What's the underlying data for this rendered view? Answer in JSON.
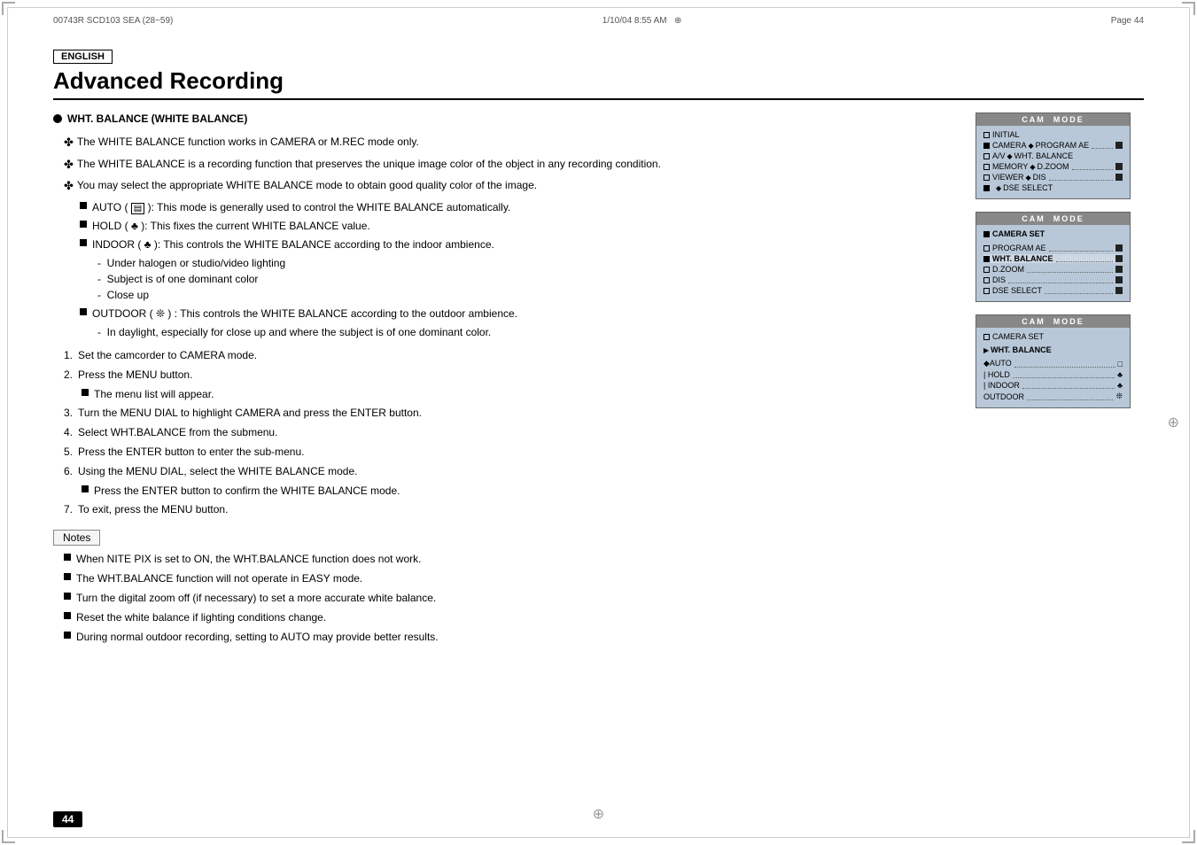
{
  "page": {
    "header": {
      "left": "00743R SCD103 SEA (28~59)",
      "center": "1/10/04  8:55 AM",
      "right": "Page 44"
    },
    "english_badge": "ENGLISH",
    "title": "Advanced Recording",
    "section": {
      "heading": "WHT. BALANCE (WHITE BALANCE)",
      "intro_items": [
        "The WHITE BALANCE function works in CAMERA or M.REC mode only.",
        "The WHITE BALANCE is a recording function that preserves the unique image color of the object in any recording condition.",
        "You may select the appropriate WHITE BALANCE mode to obtain good quality color of the image."
      ],
      "modes": [
        {
          "label": "AUTO",
          "icon": "□",
          "desc": ": This mode is generally used to control the WHITE BALANCE automatically."
        },
        {
          "label": "HOLD",
          "icon": "♣",
          "desc": ": This fixes the current WHITE BALANCE value."
        },
        {
          "label": "INDOOR",
          "icon": "♣",
          "desc": ": This controls the WHITE BALANCE according to the indoor ambience.",
          "sub": [
            "Under halogen or studio/video lighting",
            "Subject is of one dominant color",
            "Close up"
          ]
        },
        {
          "label": "OUTDOOR",
          "icon": "❊",
          "desc": ": This controls the WHITE BALANCE according to the outdoor ambience.",
          "sub": [
            "In daylight, especially for close up and where the subject is of one dominant color."
          ]
        }
      ],
      "steps": [
        {
          "num": "1.",
          "text": "Set the camcorder to CAMERA mode."
        },
        {
          "num": "2.",
          "text": "Press the MENU button.",
          "sub": "The menu list will appear."
        },
        {
          "num": "3.",
          "text": "Turn the MENU DIAL to highlight CAMERA and press the ENTER button."
        },
        {
          "num": "4.",
          "text": "Select WHT.BALANCE from the submenu."
        },
        {
          "num": "5.",
          "text": "Press the ENTER button to enter the sub-menu."
        },
        {
          "num": "6.",
          "text": "Using the MENU DIAL, select the WHITE BALANCE mode.",
          "sub": "Press the ENTER button to confirm the WHITE BALANCE mode."
        },
        {
          "num": "7.",
          "text": "To exit, press the MENU button."
        }
      ]
    },
    "notes": {
      "label": "Notes",
      "items": [
        "When NITE PIX is set to ON, the WHT.BALANCE function does not work.",
        "The WHT.BALANCE function will not operate in EASY mode.",
        "Turn the digital zoom off (if necessary) to set a more accurate white balance.",
        "Reset the white balance if lighting conditions change.",
        "During normal outdoor recording, setting to AUTO may provide better results."
      ]
    },
    "page_number": "44",
    "cam_panels": [
      {
        "header": "CAM  MODE",
        "rows": [
          {
            "icon": "box",
            "label": "INITIAL",
            "dots": false,
            "end": false,
            "indent": false
          },
          {
            "icon": "box",
            "label": "CAMERA",
            "arrow": "◆",
            "sublabel": "PROGRAM AE",
            "dots": true,
            "end": true
          },
          {
            "icon": "box",
            "label": "A/V",
            "arrow": "◆",
            "sublabel": "WHT. BALANCE",
            "dots": true,
            "end": false
          },
          {
            "icon": "box",
            "label": "MEMORY",
            "arrow": "◆",
            "sublabel": "D.ZOOM·············",
            "dots": false,
            "end": true
          },
          {
            "icon": "box",
            "label": "VIEWER",
            "arrow": "◆",
            "sublabel": "DIS·················",
            "dots": false,
            "end": true
          },
          {
            "icon": "box_filled",
            "label": "",
            "arrow": "",
            "sublabel": "◆ DSE SELECT",
            "dots": false,
            "end": false
          }
        ]
      },
      {
        "header": "CAM  MODE",
        "rows": [
          {
            "label": "CAMERA SET",
            "bold": false
          },
          {
            "label": "",
            "spacer": true
          },
          {
            "label": "PROGRAM AE ················",
            "end": true
          },
          {
            "label": "WHT. BALANCE···············",
            "end": true,
            "highlight": true
          },
          {
            "label": "D.ZOOM ··················",
            "end": true
          },
          {
            "label": "DIS ·····················",
            "end": true
          },
          {
            "label": "DSE SELECT ··············",
            "end": true
          }
        ]
      },
      {
        "header": "CAM  MODE",
        "rows": [
          {
            "label": "CAMERA SET"
          },
          {
            "label": "",
            "spacer": true
          },
          {
            "label": "WHT. BALANCE",
            "bold": true
          },
          {
            "label": "",
            "spacer": true
          },
          {
            "label": "◆AUTO  ··················",
            "end": false
          },
          {
            "label": "| HOLD  ·················",
            "end": true
          },
          {
            "label": "| INDOOR ················",
            "end": false
          },
          {
            "label": "OUTDOOR·················",
            "end": true
          }
        ]
      }
    ]
  }
}
